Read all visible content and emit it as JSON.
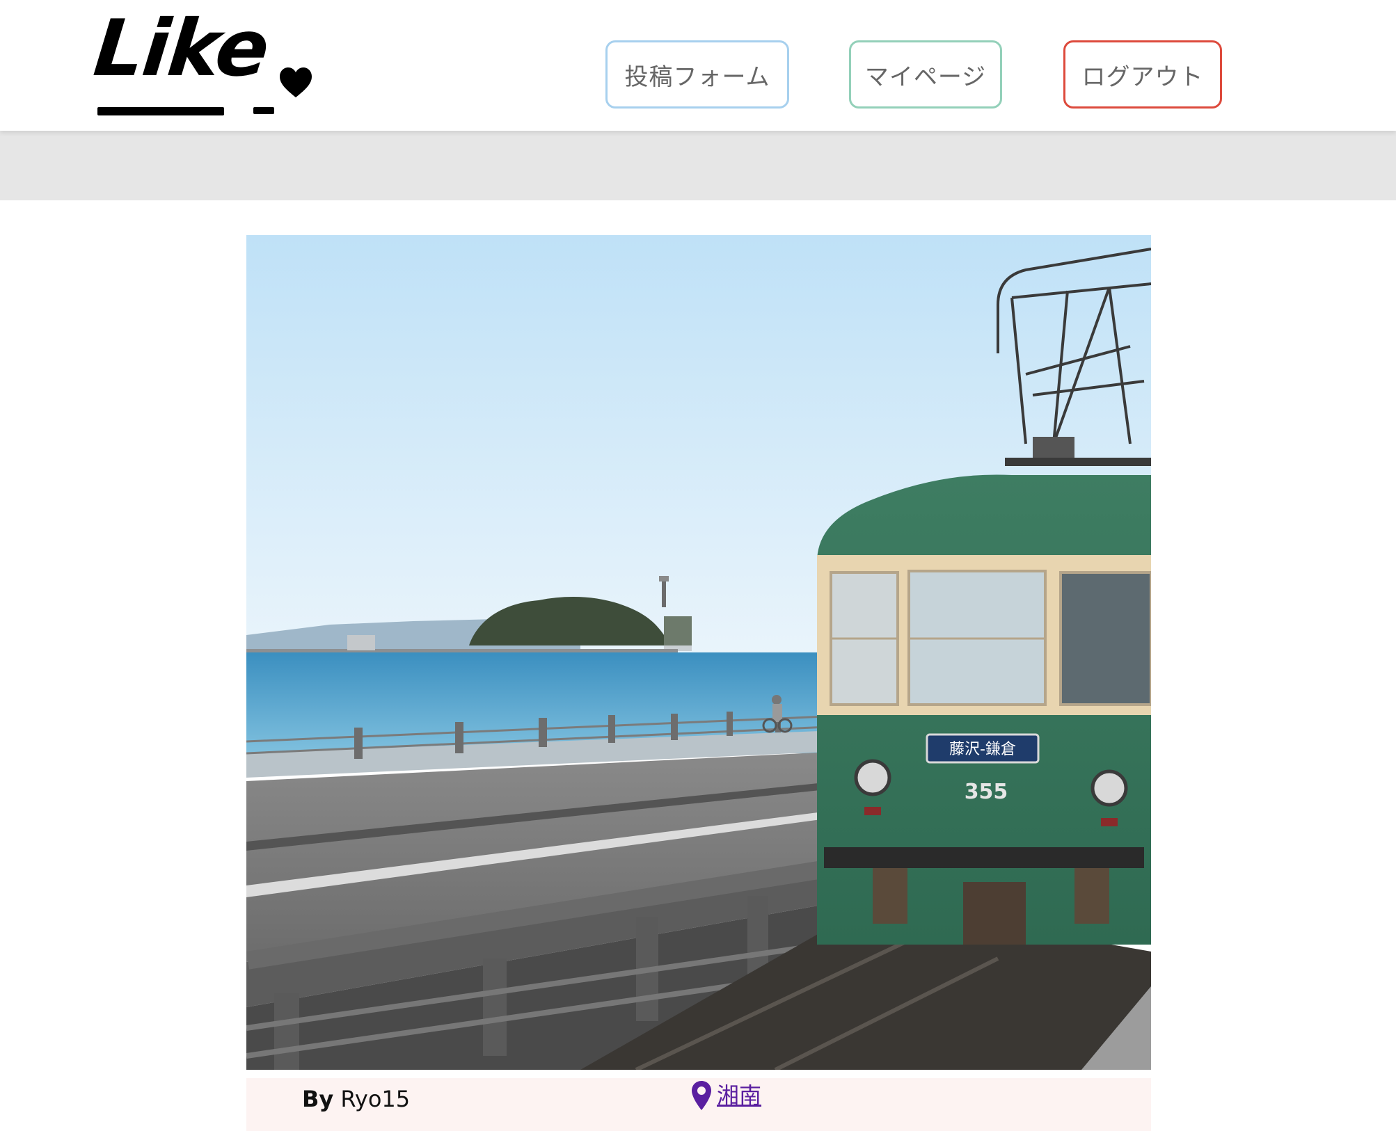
{
  "header": {
    "logo_text": "Like",
    "nav": {
      "post_form": "投稿フォーム",
      "my_page": "マイページ",
      "logout": "ログアウト"
    },
    "button_colors": {
      "post_form": "#a7d0ee",
      "my_page": "#93d0b9",
      "logout": "#dd4a3c"
    }
  },
  "post": {
    "by_label": "By",
    "author": "Ryo15",
    "location": "湘南",
    "train_sign": "藤沢-鎌倉",
    "train_number": "355"
  },
  "icons": {
    "heart": "heart-icon",
    "location": "map-pin-icon"
  }
}
